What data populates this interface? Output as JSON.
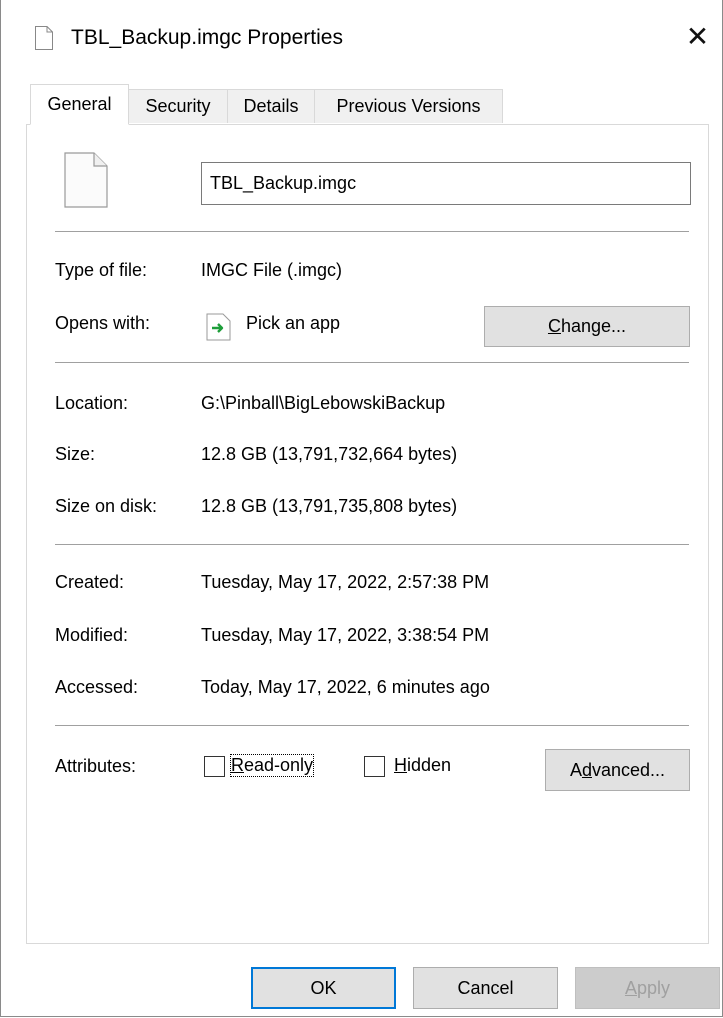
{
  "window": {
    "title": "TBL_Backup.imgc Properties",
    "close_glyph": "✕"
  },
  "tabs": [
    {
      "label": "General",
      "active": true
    },
    {
      "label": "Security",
      "active": false
    },
    {
      "label": "Details",
      "active": false
    },
    {
      "label": "Previous Versions",
      "active": false
    }
  ],
  "general": {
    "file_name": "TBL_Backup.imgc",
    "type_label": "Type of file:",
    "type_value": "IMGC File (.imgc)",
    "opens_label": "Opens with:",
    "opens_value": "Pick an app",
    "change_label_pre": "",
    "change_label_acc": "C",
    "change_label_post": "hange...",
    "location_label": "Location:",
    "location_value": "G:\\Pinball\\BigLebowskiBackup",
    "size_label": "Size:",
    "size_value": "12.8 GB (13,791,732,664 bytes)",
    "size_disk_label": "Size on disk:",
    "size_disk_value": "12.8 GB (13,791,735,808 bytes)",
    "created_label": "Created:",
    "created_value": "Tuesday, May 17, 2022, 2:57:38 PM",
    "modified_label": "Modified:",
    "modified_value": "Tuesday, May 17, 2022, 3:38:54 PM",
    "accessed_label": "Accessed:",
    "accessed_value": "Today, May 17, 2022, 6 minutes ago",
    "attributes_label": "Attributes:",
    "readonly_acc": "R",
    "readonly_rest": "ead-only",
    "readonly_checked": false,
    "hidden_acc": "H",
    "hidden_rest": "idden",
    "hidden_checked": false,
    "advanced_pre": "A",
    "advanced_acc": "d",
    "advanced_post": "vanced..."
  },
  "footer": {
    "ok_label": "OK",
    "cancel_label": "Cancel",
    "apply_acc": "A",
    "apply_rest": "pply"
  },
  "colors": {
    "accent": "#0078d7",
    "arrow_green": "#1e9e3a"
  }
}
